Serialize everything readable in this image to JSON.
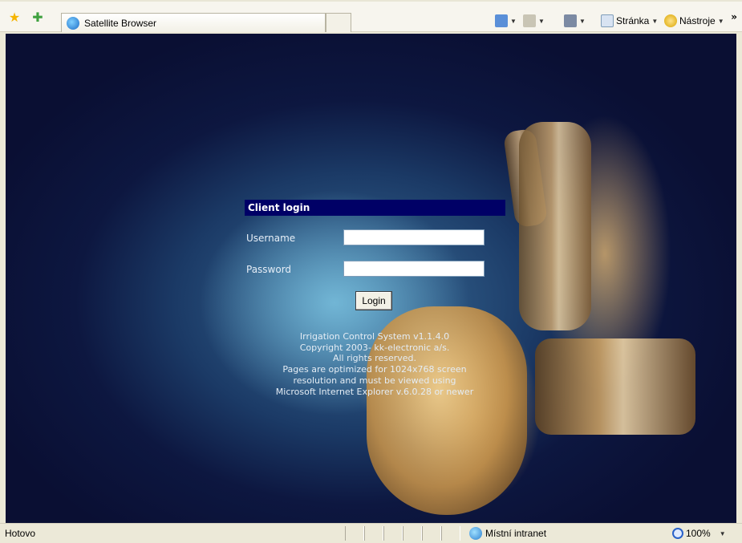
{
  "toolbar": {
    "tab_title": "Satellite Browser",
    "page_menu": "Stránka",
    "tools_menu": "Nástroje",
    "more_glyph": "»",
    "icons": [
      "favorites-star-icon",
      "add-favorite-icon",
      "home-icon",
      "feeds-icon",
      "print-icon",
      "page-icon",
      "tools-gear-icon"
    ]
  },
  "login": {
    "header": "Client login",
    "username_label": "Username",
    "password_label": "Password",
    "username_value": "",
    "password_value": "",
    "button": "Login"
  },
  "footer": {
    "lines": [
      "Irrigation Control System v1.1.4.0",
      "Copyright 2003- kk-electronic a/s.",
      "All rights reserved.",
      "Pages are optimized for 1024x768 screen",
      "resolution and must be viewed using",
      "Microsoft Internet Explorer v.6.0.28 or newer"
    ]
  },
  "status": {
    "text": "Hotovo",
    "zone": "Místní intranet",
    "zoom": "100%"
  },
  "colors": {
    "login_header_bg": "#000066",
    "footer_text": "#e4ecf4"
  }
}
